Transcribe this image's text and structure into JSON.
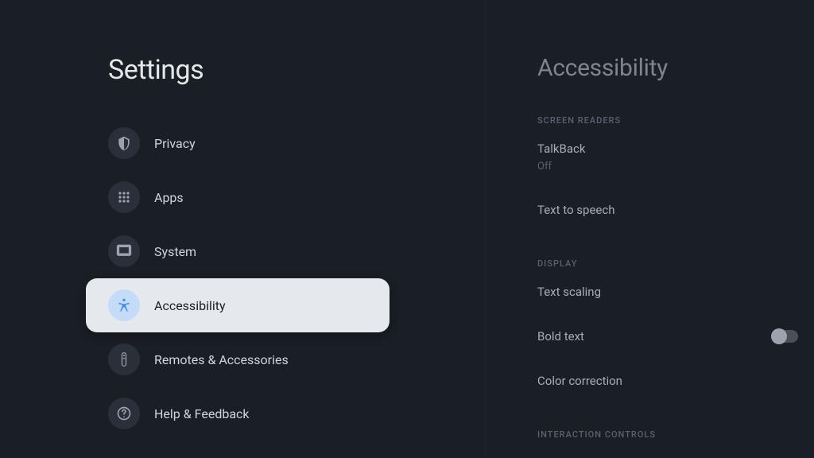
{
  "settings": {
    "title": "Settings",
    "items": [
      {
        "label": "Privacy",
        "icon": "shield"
      },
      {
        "label": "Apps",
        "icon": "grid"
      },
      {
        "label": "System",
        "icon": "monitor"
      },
      {
        "label": "Accessibility",
        "icon": "accessibility",
        "selected": true
      },
      {
        "label": "Remotes & Accessories",
        "icon": "remote"
      },
      {
        "label": "Help & Feedback",
        "icon": "help"
      }
    ]
  },
  "detail": {
    "title": "Accessibility",
    "sections": [
      {
        "header": "Screen readers",
        "items": [
          {
            "title": "TalkBack",
            "subtitle": "Off"
          },
          {
            "title": "Text to speech"
          }
        ]
      },
      {
        "header": "Display",
        "items": [
          {
            "title": "Text scaling"
          },
          {
            "title": "Bold text",
            "toggle": true,
            "toggle_state": "off"
          },
          {
            "title": "Color correction"
          }
        ]
      },
      {
        "header": "Interaction controls",
        "items": []
      }
    ]
  }
}
